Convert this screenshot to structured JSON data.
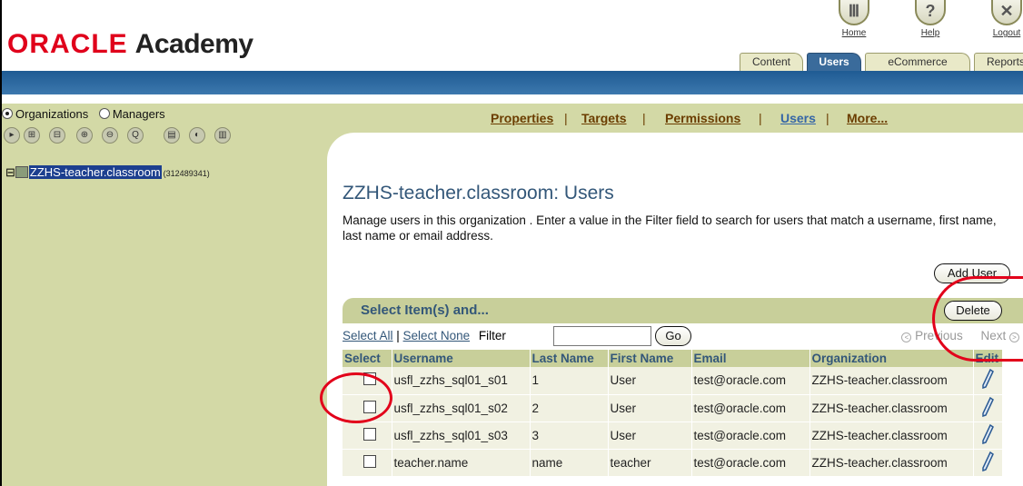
{
  "header": {
    "logo_oracle": "ORACLE",
    "logo_academy": "Academy",
    "icons": [
      {
        "label": "Home",
        "icon": "home-icon",
        "glyph": "Ⅲ"
      },
      {
        "label": "Help",
        "icon": "help-icon",
        "glyph": "?"
      },
      {
        "label": "Logout",
        "icon": "logout-icon",
        "glyph": "✕"
      }
    ],
    "tabs": [
      "Content",
      "Users",
      "eCommerce",
      "Reports"
    ],
    "active_tab": "Users"
  },
  "left": {
    "radio_organizations": "Organizations",
    "radio_managers": "Managers",
    "tree_node": "ZZHS-teacher.classroom",
    "tree_node_id": "(312489341)"
  },
  "subnav": {
    "items": [
      "Properties",
      "Targets",
      "Permissions",
      "Users",
      "More..."
    ],
    "current": "Users"
  },
  "page": {
    "title": "ZZHS-teacher.classroom: Users",
    "description": "Manage users in this organization . Enter a value in the Filter field to search for users that match a username, first name, last name or email address.",
    "add_user": "Add User",
    "select_items": "Select Item(s) and...",
    "delete": "Delete",
    "select_all": "Select All",
    "select_none": "Select None",
    "filter_label": "Filter",
    "filter_value": "",
    "go": "Go",
    "previous": "Previous",
    "next": "Next"
  },
  "table": {
    "headers": [
      "Select",
      "Username",
      "Last Name",
      "First Name",
      "Email",
      "Organization",
      "Edit"
    ],
    "rows": [
      {
        "username": "usfl_zzhs_sql01_s01",
        "last": "1",
        "first": "User",
        "email": "test@oracle.com",
        "org": "ZZHS-teacher.classroom"
      },
      {
        "username": "usfl_zzhs_sql01_s02",
        "last": "2",
        "first": "User",
        "email": "test@oracle.com",
        "org": "ZZHS-teacher.classroom"
      },
      {
        "username": "usfl_zzhs_sql01_s03",
        "last": "3",
        "first": "User",
        "email": "test@oracle.com",
        "org": "ZZHS-teacher.classroom"
      },
      {
        "username": "teacher.name",
        "last": "name",
        "first": "teacher",
        "email": "test@oracle.com",
        "org": "ZZHS-teacher.classroom"
      }
    ]
  },
  "colors": {
    "accent_blue": "#335779",
    "panel_olive": "#d3d9a6",
    "oracle_red": "#e0001b",
    "annotation_red": "#e2001a"
  }
}
